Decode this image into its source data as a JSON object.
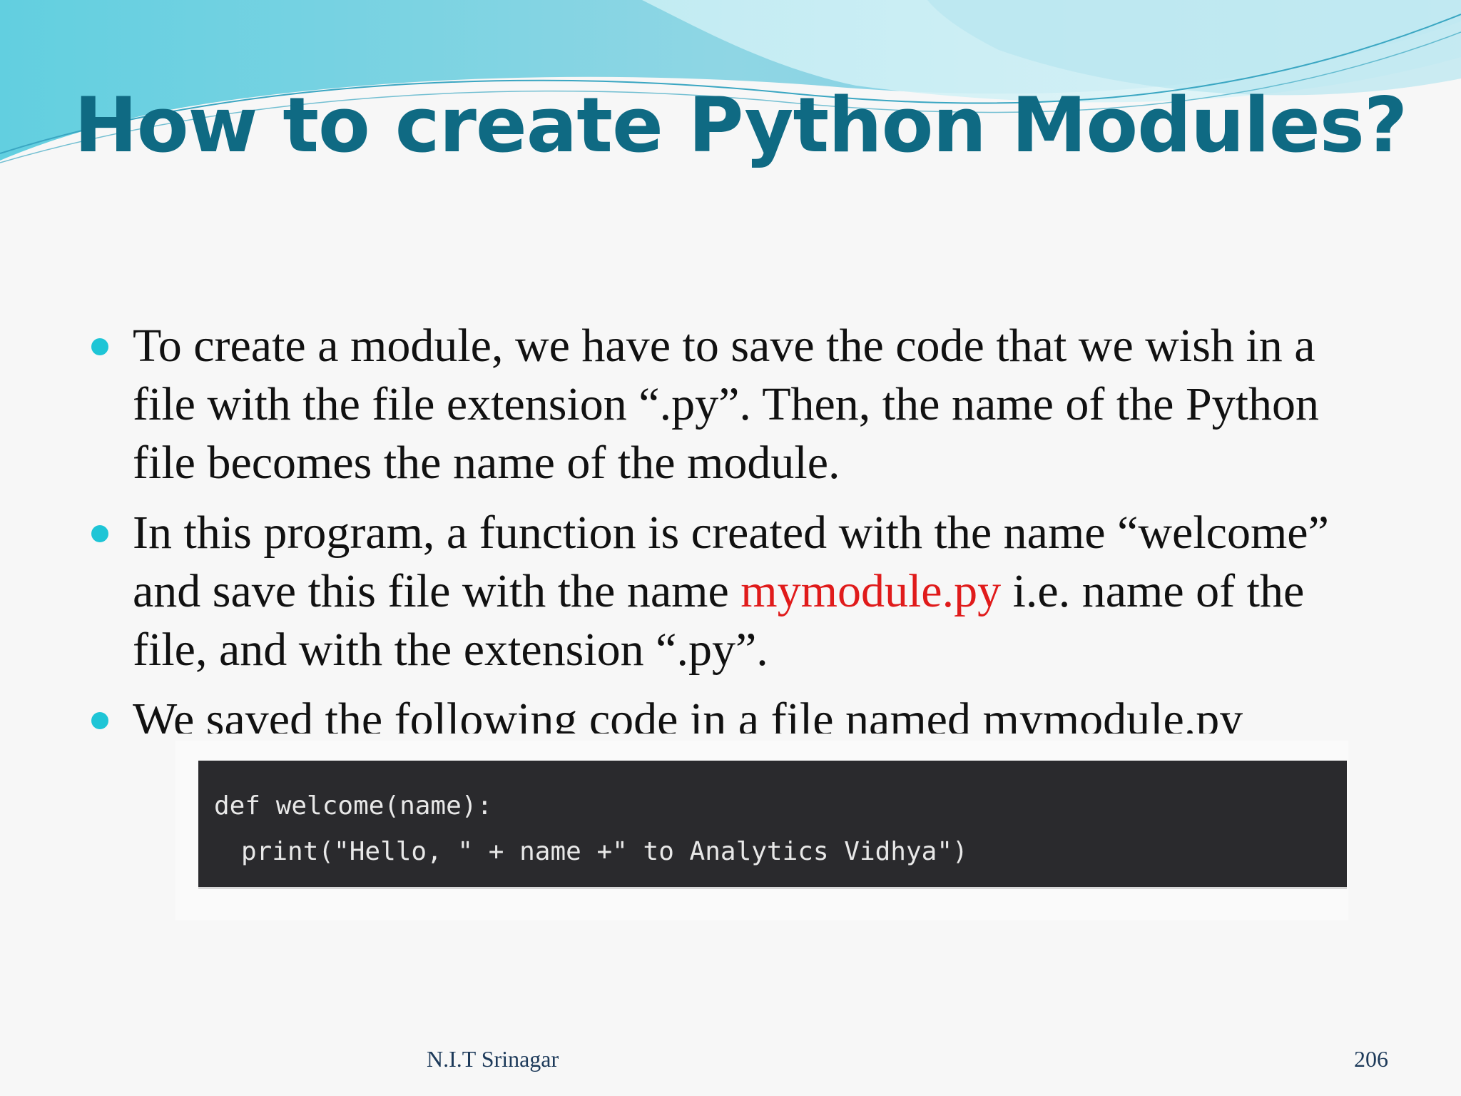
{
  "slide": {
    "title": "How to create Python Modules?",
    "bullets": [
      {
        "text": "To create a module, we have to save the code that we wish in a file with the file extension “.py”. Then, the name of the Python file becomes the name of the module."
      },
      {
        "text_before": "In this program, a function is created with the name “welcome” and save this file with the name ",
        "highlight": "mymodule.py",
        "text_after": " i.e. name of the file, and with the extension “.py”."
      },
      {
        "text": "We saved the following code in a file named mymodule.py"
      }
    ],
    "code": {
      "line1": "def welcome(name):",
      "line2": "print(\"Hello, \" + name +\" to Analytics Vidhya\")"
    },
    "footer": {
      "center": "N.I.T Srinagar",
      "page_number": "206"
    }
  },
  "colors": {
    "title": "#0f6a83",
    "bullet_dot": "#1ec5d6",
    "highlight": "#e01b1b",
    "code_background": "#2a2a2d"
  },
  "icons": {
    "bullet": "bullet-dot-icon"
  }
}
